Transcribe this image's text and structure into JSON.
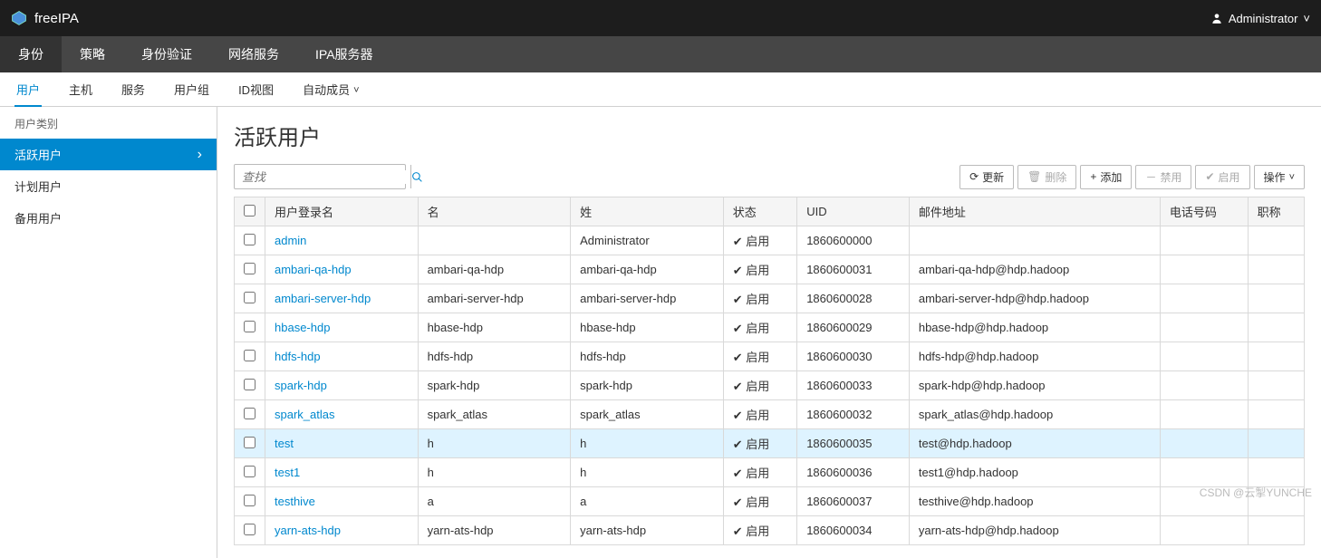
{
  "brand": "freeIPA",
  "user": "Administrator",
  "nav": {
    "items": [
      "身份",
      "策略",
      "身份验证",
      "网络服务",
      "IPA服务器"
    ],
    "activeIndex": 0
  },
  "subnav": {
    "items": [
      "用户",
      "主机",
      "服务",
      "用户组",
      "ID视图",
      "自动成员"
    ],
    "activeIndex": 0,
    "dropdownIndex": 5
  },
  "sidebar": {
    "title": "用户类别",
    "items": [
      "活跃用户",
      "计划用户",
      "备用用户"
    ],
    "activeIndex": 0
  },
  "page": {
    "title": "活跃用户",
    "searchPlaceholder": "查找"
  },
  "toolbar": {
    "refresh": "更新",
    "delete": "删除",
    "add": "添加",
    "disable": "禁用",
    "enable": "启用",
    "ops": "操作"
  },
  "table": {
    "headers": [
      "用户登录名",
      "名",
      "姓",
      "状态",
      "UID",
      "邮件地址",
      "电话号码",
      "职称"
    ],
    "statusLabel": "启用",
    "highlightIndex": 7,
    "rows": [
      {
        "login": "admin",
        "first": "",
        "last": "Administrator",
        "uid": "1860600000",
        "email": "",
        "phone": "",
        "title": ""
      },
      {
        "login": "ambari-qa-hdp",
        "first": "ambari-qa-hdp",
        "last": "ambari-qa-hdp",
        "uid": "1860600031",
        "email": "ambari-qa-hdp@hdp.hadoop",
        "phone": "",
        "title": ""
      },
      {
        "login": "ambari-server-hdp",
        "first": "ambari-server-hdp",
        "last": "ambari-server-hdp",
        "uid": "1860600028",
        "email": "ambari-server-hdp@hdp.hadoop",
        "phone": "",
        "title": ""
      },
      {
        "login": "hbase-hdp",
        "first": "hbase-hdp",
        "last": "hbase-hdp",
        "uid": "1860600029",
        "email": "hbase-hdp@hdp.hadoop",
        "phone": "",
        "title": ""
      },
      {
        "login": "hdfs-hdp",
        "first": "hdfs-hdp",
        "last": "hdfs-hdp",
        "uid": "1860600030",
        "email": "hdfs-hdp@hdp.hadoop",
        "phone": "",
        "title": ""
      },
      {
        "login": "spark-hdp",
        "first": "spark-hdp",
        "last": "spark-hdp",
        "uid": "1860600033",
        "email": "spark-hdp@hdp.hadoop",
        "phone": "",
        "title": ""
      },
      {
        "login": "spark_atlas",
        "first": "spark_atlas",
        "last": "spark_atlas",
        "uid": "1860600032",
        "email": "spark_atlas@hdp.hadoop",
        "phone": "",
        "title": ""
      },
      {
        "login": "test",
        "first": "h",
        "last": "h",
        "uid": "1860600035",
        "email": "test@hdp.hadoop",
        "phone": "",
        "title": ""
      },
      {
        "login": "test1",
        "first": "h",
        "last": "h",
        "uid": "1860600036",
        "email": "test1@hdp.hadoop",
        "phone": "",
        "title": ""
      },
      {
        "login": "testhive",
        "first": "a",
        "last": "a",
        "uid": "1860600037",
        "email": "testhive@hdp.hadoop",
        "phone": "",
        "title": ""
      },
      {
        "login": "yarn-ats-hdp",
        "first": "yarn-ats-hdp",
        "last": "yarn-ats-hdp",
        "uid": "1860600034",
        "email": "yarn-ats-hdp@hdp.hadoop",
        "phone": "",
        "title": ""
      }
    ]
  },
  "watermark": "CSDN @云掣YUNCHE"
}
